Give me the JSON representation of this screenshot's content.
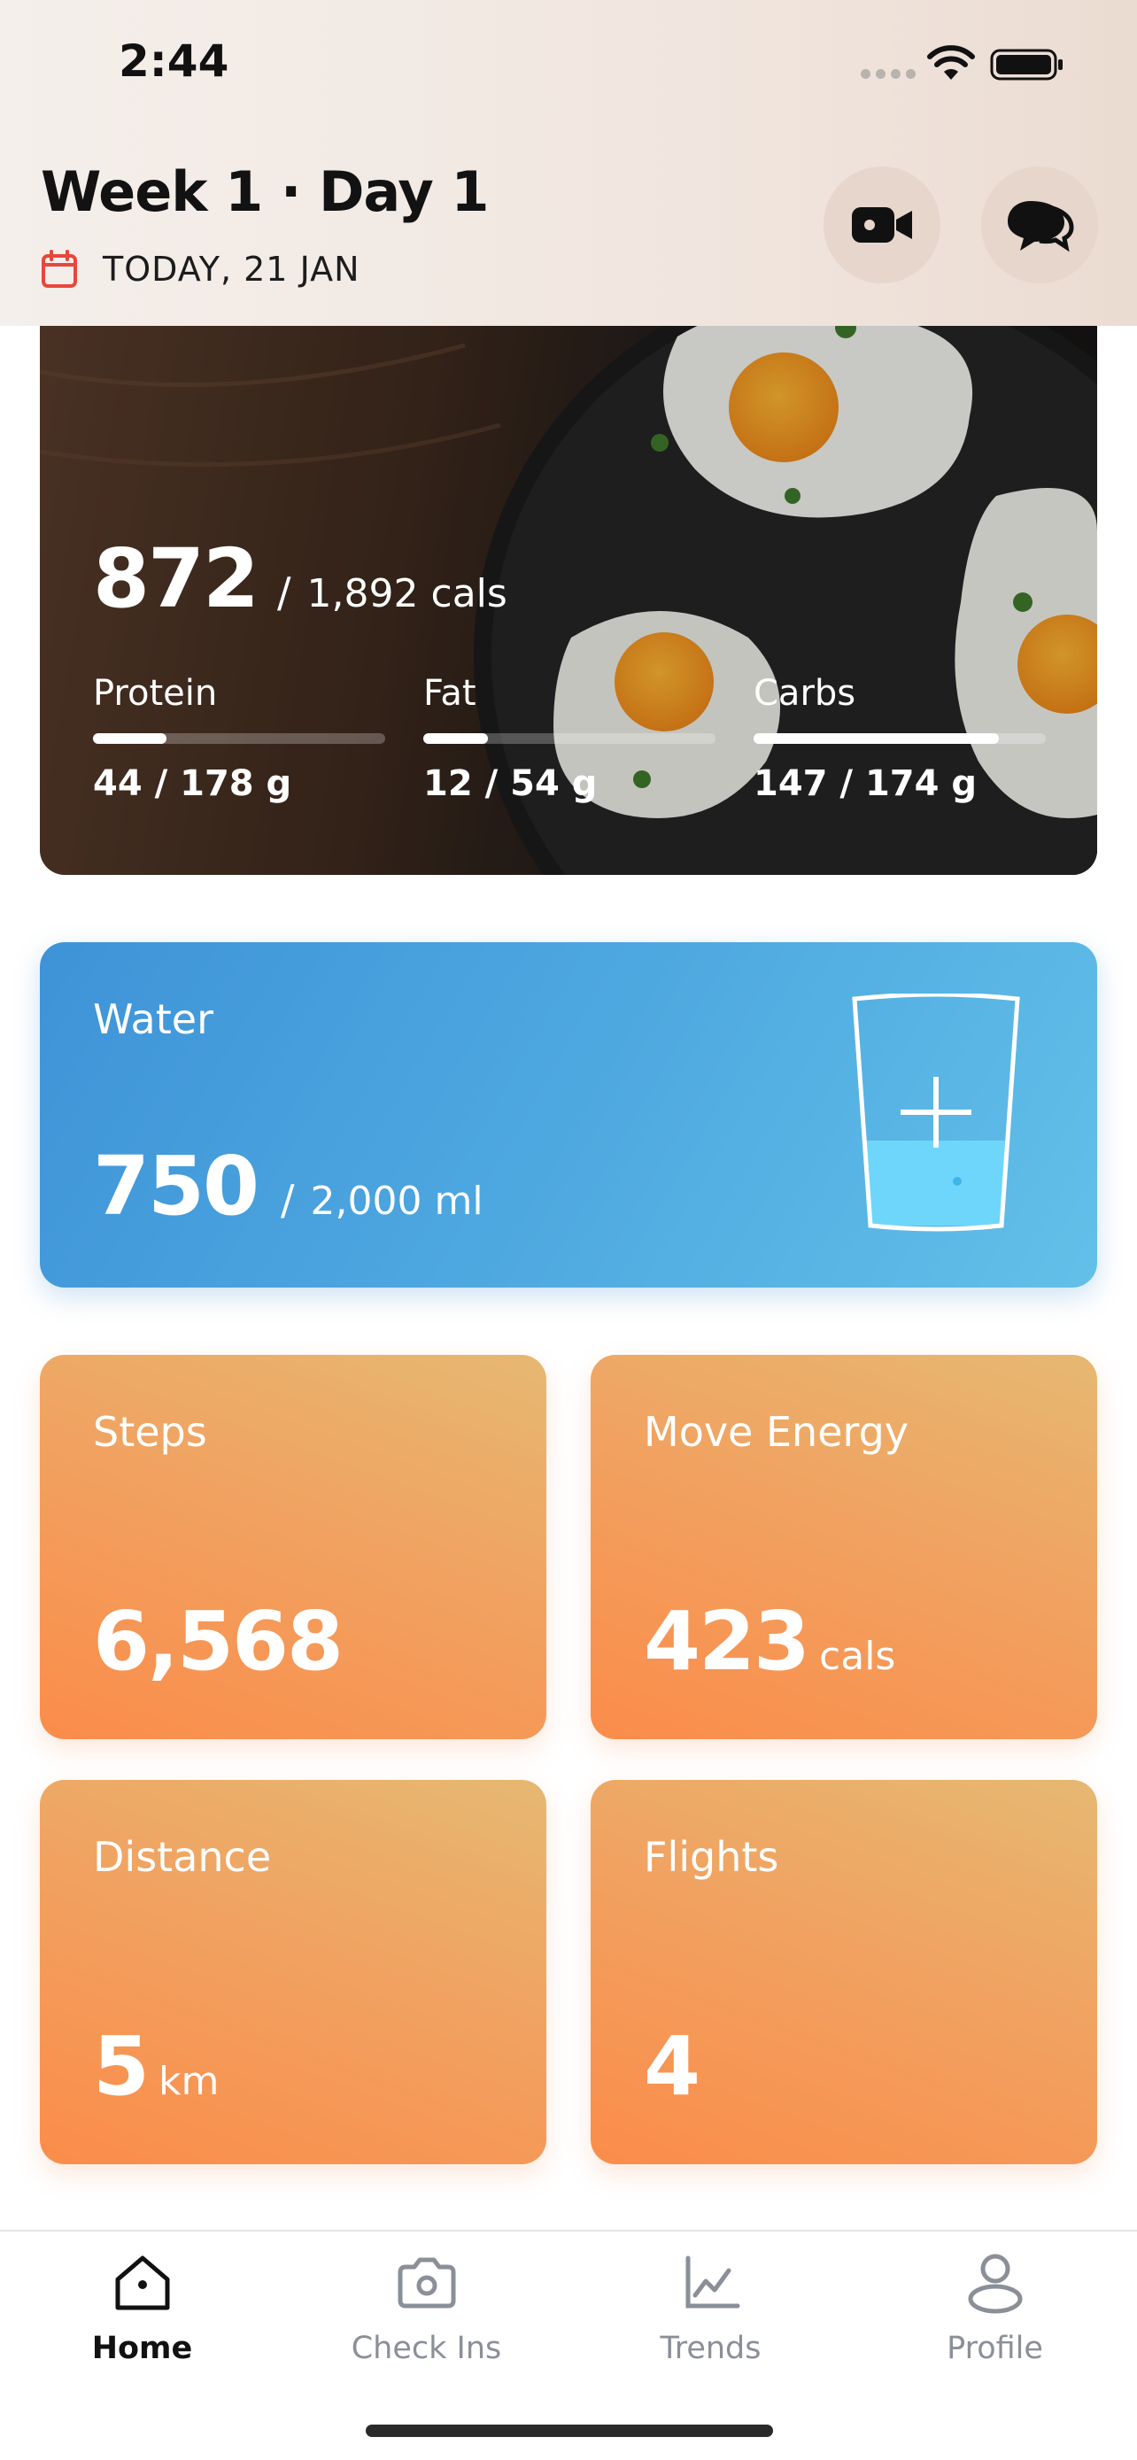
{
  "status_bar": {
    "time": "2:44"
  },
  "header": {
    "title": "Week 1 · Day 1",
    "date": "TODAY, 21 JAN",
    "icons": [
      "calendar-icon",
      "video-icon",
      "chat-icon"
    ]
  },
  "nutrition": {
    "calories_consumed": "872",
    "calories_goal": "1,892 cals",
    "macros": [
      {
        "label": "Protein",
        "value": "44 / 178 g",
        "progress": 0.25
      },
      {
        "label": "Fat",
        "value": "12 / 54 g",
        "progress": 0.22
      },
      {
        "label": "Carbs",
        "value": "147 / 174 g",
        "progress": 0.84
      }
    ]
  },
  "water": {
    "label": "Water",
    "amount": "750",
    "goal": "2,000 ml",
    "fill_fraction": 0.375
  },
  "activity": [
    {
      "label": "Steps",
      "value": "6,568",
      "unit": ""
    },
    {
      "label": "Move Energy",
      "value": "423",
      "unit": "cals"
    },
    {
      "label": "Distance",
      "value": "5",
      "unit": "km"
    },
    {
      "label": "Flights",
      "value": "4",
      "unit": ""
    }
  ],
  "tabs": [
    {
      "label": "Home",
      "icon": "home-icon",
      "active": true
    },
    {
      "label": "Check Ins",
      "icon": "camera-icon",
      "active": false
    },
    {
      "label": "Trends",
      "icon": "trends-icon",
      "active": false
    },
    {
      "label": "Profile",
      "icon": "profile-icon",
      "active": false
    }
  ],
  "colors": {
    "accent_orange": "#fb8c4a",
    "water_blue": "#4ea8e0",
    "calendar_red": "#e8473b"
  }
}
